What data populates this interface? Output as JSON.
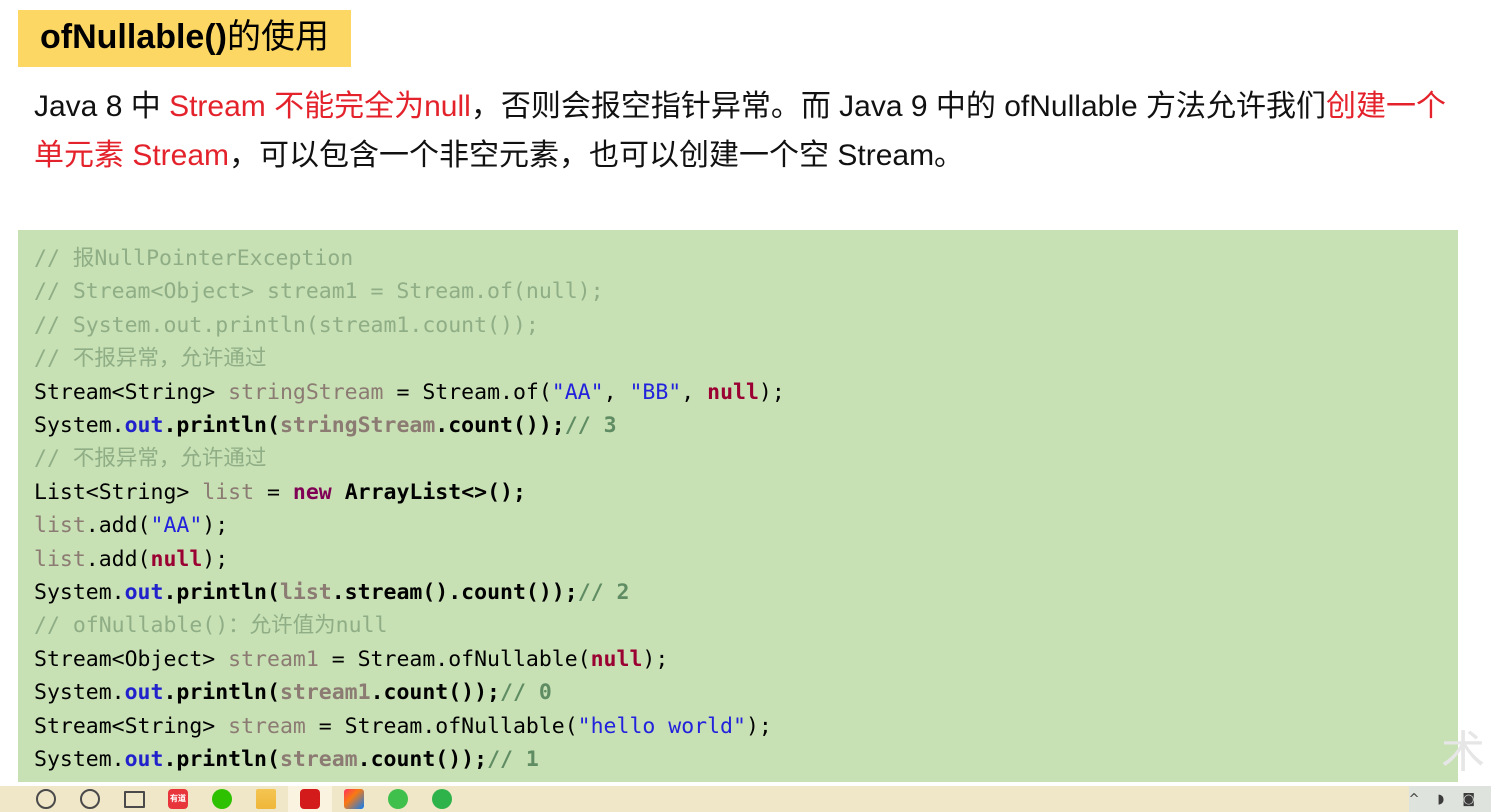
{
  "slide": {
    "title": {
      "en": "ofNullable()",
      "cn": "的使用",
      "highlight_color": "#fcd764"
    },
    "paragraph": {
      "segments": [
        {
          "text": "Java 8 中 ",
          "color": "black"
        },
        {
          "text": "Stream 不能完全为null",
          "color": "red"
        },
        {
          "text": "，否则会报空指针异常。而 Java 9 中的 ofNullable 方法允许我们",
          "color": "black"
        },
        {
          "text": "创建一个单元素 Stream",
          "color": "red"
        },
        {
          "text": "，可以包含一个非空元素，也可以创建一个空 Stream。",
          "color": "black"
        }
      ],
      "red_color": "#e4222b"
    },
    "watermark": "术"
  },
  "code_block": {
    "background": "#c7e0b4",
    "comment_color": "#8fae86",
    "string_color": "#2222dd",
    "keyword_color": "#7f0055",
    "null_color": "#9b0032",
    "lines": [
      "// 报NullPointerException",
      "// Stream<Object> stream1 = Stream.of(null);",
      "// System.out.println(stream1.count());",
      "// 不报异常，允许通过",
      "Stream<String> stringStream = Stream.of(\"AA\", \"BB\", null);",
      "System.out.println(stringStream.count());// 3",
      "// 不报异常，允许通过",
      "List<String> list = new ArrayList<>();",
      "list.add(\"AA\");",
      "list.add(null);",
      "System.out.println(list.stream().count());// 2",
      "// ofNullable()：允许值为null",
      "Stream<Object> stream1 = Stream.ofNullable(null);",
      "System.out.println(stream1.count());// 0",
      "Stream<String> stream = Stream.ofNullable(\"hello world\");",
      "System.out.println(stream.count());// 1"
    ],
    "tokens": {
      "l1_comment": "// 报NullPointerException",
      "l2_comment": "// Stream<Object> stream1 = Stream.of(null);",
      "l3_comment": "// System.out.println(stream1.count());",
      "l4_comment": "// 不报异常，允许通过",
      "l5_type": "Stream<String> ",
      "l5_var": "stringStream",
      "l5_mid": " = Stream.of(",
      "l5_s1": "\"AA\"",
      "l5_sep1": ", ",
      "l5_s2": "\"BB\"",
      "l5_sep2": ", ",
      "l5_null": "null",
      "l5_end": ");",
      "l6_a": "System.",
      "l6_out": "out",
      "l6_b": ".println(",
      "l6_var": "stringStream",
      "l6_c": ".count());",
      "l6_cm": "// 3",
      "l7_comment": "// 不报异常，允许通过",
      "l8_type": "List<String> ",
      "l8_var": "list",
      "l8_eq": " = ",
      "l8_new": "new",
      "l8_cls": " ArrayList<>();",
      "l9_var": "list",
      "l9_a": ".add(",
      "l9_s": "\"AA\"",
      "l9_b": ");",
      "l10_var": "list",
      "l10_a": ".add(",
      "l10_null": "null",
      "l10_b": ");",
      "l11_a": "System.",
      "l11_out": "out",
      "l11_b": ".println(",
      "l11_var": "list",
      "l11_c": ".stream().count());",
      "l11_cm": "// 2",
      "l12_comment": "// ofNullable()：允许值为null",
      "l13_type": "Stream<Object> ",
      "l13_var": "stream1",
      "l13_mid": " = Stream.ofNullable(",
      "l13_null": "null",
      "l13_end": ");",
      "l14_a": "System.",
      "l14_out": "out",
      "l14_b": ".println(",
      "l14_var": "stream1",
      "l14_c": ".count());",
      "l14_cm": "// 0",
      "l15_type": "Stream<String> ",
      "l15_var": "stream",
      "l15_mid": " = Stream.ofNullable(",
      "l15_s": "\"hello world\"",
      "l15_end": ");",
      "l16_a": "System.",
      "l16_out": "out",
      "l16_b": ".println(",
      "l16_var": "stream",
      "l16_c": ".count());",
      "l16_cm": "// 1"
    }
  },
  "taskbar": {
    "background": "#f0e7c8",
    "items": [
      {
        "name": "start-icon",
        "label": ""
      },
      {
        "name": "search-icon",
        "label": ""
      },
      {
        "name": "task-view-icon",
        "label": ""
      },
      {
        "name": "youdao-icon",
        "label": "有道"
      },
      {
        "name": "wechat-icon",
        "label": ""
      },
      {
        "name": "file-explorer-icon",
        "label": ""
      },
      {
        "name": "pdf-reader-icon",
        "label": ""
      },
      {
        "name": "intellij-idea-icon",
        "label": ""
      },
      {
        "name": "green-app-icon",
        "label": ""
      },
      {
        "name": "green-app2-icon",
        "label": ""
      }
    ],
    "tray": [
      {
        "name": "show-hidden-icons-icon",
        "glyph": "^"
      },
      {
        "name": "network-icon",
        "glyph": "◗"
      },
      {
        "name": "volume-icon",
        "glyph": "◙"
      }
    ]
  }
}
